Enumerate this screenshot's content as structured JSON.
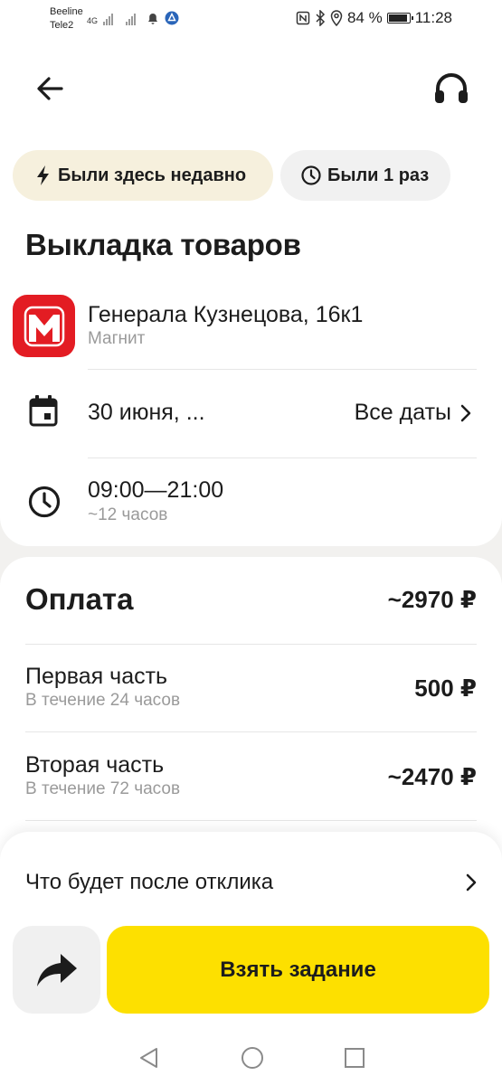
{
  "status_bar": {
    "carrier1": "Beeline",
    "carrier2": "Tele2",
    "net1": "4G",
    "battery_text": "84 %",
    "battery_level": 0.84,
    "time": "11:28"
  },
  "header": {
    "back_icon": "arrow-left-icon",
    "support_icon": "headset-icon"
  },
  "chips": {
    "recent": "Были здесь недавно",
    "visits": "Были 1 раз"
  },
  "task": {
    "title": "Выкладка товаров",
    "store_address": "Генерала Кузнецова, 16к1",
    "store_name": "Магнит",
    "date": "30 июня, ...",
    "all_dates": "Все даты",
    "time_range": "09:00—21:00",
    "duration": "~12 часов"
  },
  "payment": {
    "title": "Оплата",
    "total": "~2970 ₽",
    "parts": [
      {
        "label": "Первая часть",
        "sub": "В течение 24 часов",
        "amount": "500 ₽"
      },
      {
        "label": "Вторая часть",
        "sub": "В течение 72 часов",
        "amount": "~2470 ₽"
      }
    ]
  },
  "bottom": {
    "after_response": "Что будет после отклика",
    "take_task": "Взять задание"
  },
  "colors": {
    "accent_yellow": "#fde000",
    "brand_red": "#e31c23",
    "chip_recent_bg": "#f6f0dd",
    "muted_text": "#9a9a9a"
  }
}
